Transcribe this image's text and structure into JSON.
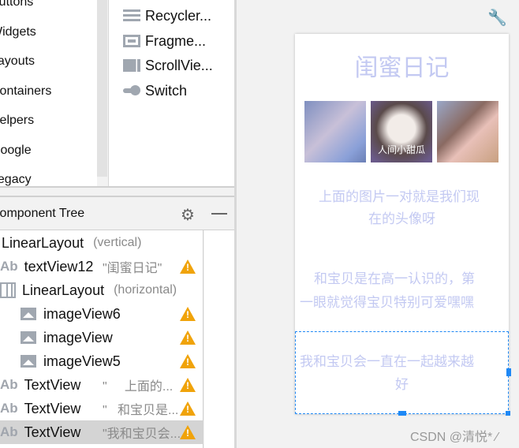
{
  "palette": {
    "categories": [
      "Buttons",
      "Widgets",
      "Layouts",
      "Containers",
      "Helpers",
      "Google",
      "Legacy"
    ],
    "components": [
      {
        "label": "Recycler...",
        "icon": "list-icon"
      },
      {
        "label": "Fragme...",
        "icon": "fragment-icon"
      },
      {
        "label": "ScrollVie...",
        "icon": "scrollview-icon"
      },
      {
        "label": "Switch",
        "icon": "switch-icon"
      }
    ]
  },
  "component_tree": {
    "title": "Component Tree",
    "rows": [
      {
        "name": "LinearLayout",
        "detail": "(vertical)",
        "icon": "layout-icon",
        "warn": false
      },
      {
        "name": "textView12",
        "detail": "\"闺蜜日记\"",
        "icon": "text-icon",
        "warn": true
      },
      {
        "name": "LinearLayout",
        "detail": "(horizontal)",
        "icon": "horizontal-layout-icon",
        "warn": false
      },
      {
        "name": "imageView6",
        "detail": "",
        "icon": "image-icon",
        "warn": true
      },
      {
        "name": "imageView",
        "detail": "",
        "icon": "image-icon",
        "warn": true
      },
      {
        "name": "imageView5",
        "detail": "",
        "icon": "image-icon",
        "warn": true
      },
      {
        "name": "TextView",
        "detail": "\"     上面的...",
        "icon": "text-icon",
        "warn": true
      },
      {
        "name": "TextView",
        "detail": "\"   和宝贝是...",
        "icon": "text-icon",
        "warn": true
      },
      {
        "name": "TextView",
        "detail": "\"我和宝贝会...",
        "icon": "text-icon",
        "warn": true,
        "selected": true
      }
    ]
  },
  "preview": {
    "title": "闺蜜日记",
    "image_caption": "人间小甜瓜",
    "text1": [
      "上面的图片一对就是我们现",
      "在的头像呀"
    ],
    "text2": [
      "和宝贝是在高一认识的，第",
      "一眼就觉得宝贝特别可爱嘿嘿"
    ],
    "text3": [
      "我和宝贝会一直在一起越来越",
      "好"
    ],
    "text_color": "#c3c9f2",
    "selection_color": "#1e88f5"
  },
  "watermark": "CSDN @清悦* ⁄"
}
